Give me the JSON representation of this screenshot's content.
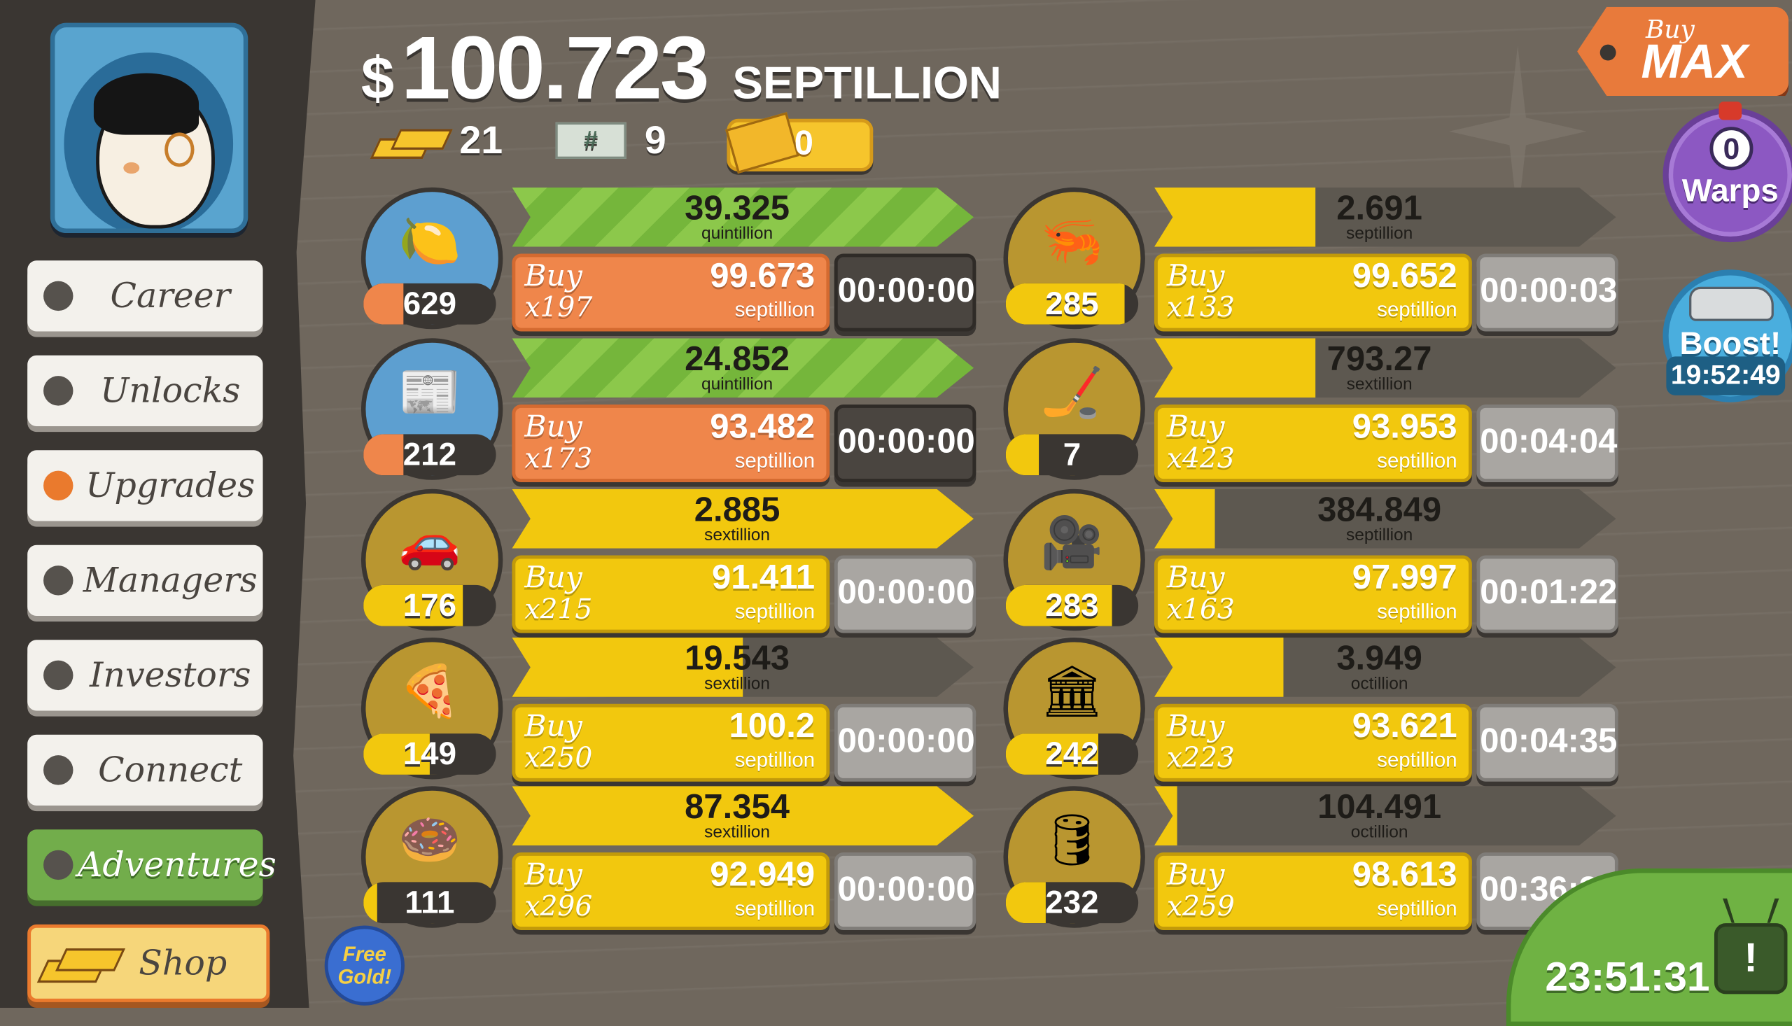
{
  "header": {
    "currency_symbol": "$",
    "money_amount": "100.723",
    "money_unit": "SEPTILLION",
    "gold_count": "21",
    "megabucks_count": "9",
    "megabuck_symbol": "#",
    "tickets_count": "0"
  },
  "buy_max": {
    "line1": "Buy",
    "line2": "MAX"
  },
  "warps": {
    "count": "0",
    "label": "Warps"
  },
  "boost": {
    "label": "Boost!",
    "timer": "19:52:49"
  },
  "menu": {
    "career": "Career",
    "unlocks": "Unlocks",
    "upgrades": "Upgrades",
    "managers": "Managers",
    "investors": "Investors",
    "connect": "Connect",
    "adventures": "Adventures",
    "shop": "Shop"
  },
  "free_gold": {
    "line1": "Free",
    "line2": "Gold!"
  },
  "tv_timer": "23:51:31",
  "tv_icon": "!",
  "colors": {
    "bar_green": "#8cc84b",
    "bar_yellow": "#f2c80e",
    "buy_orange": "#ef864b",
    "buy_yellow": "#f2c80e",
    "owned_fill": "#f2c80e",
    "owned_fill_orange": "#ef864b"
  },
  "businesses": [
    {
      "icon": "lemon-icon",
      "glyph": "🍋",
      "owned": "629",
      "owned_progress": 0.3,
      "owned_fill": "orange",
      "circle": "blue",
      "revenue": "39.325",
      "revenue_unit": "quintillion",
      "bar_progress": 1.0,
      "bar_style": "green",
      "buy_label": "Buy",
      "buy_qty": "x197",
      "price": "99.673",
      "price_unit": "septillion",
      "buy_style": "orange",
      "timer": "00:00:00",
      "timer_style": "dark"
    },
    {
      "icon": "newspaper-icon",
      "glyph": "📰",
      "owned": "212",
      "owned_progress": 0.3,
      "owned_fill": "orange",
      "circle": "blue",
      "revenue": "24.852",
      "revenue_unit": "quintillion",
      "bar_progress": 1.0,
      "bar_style": "green",
      "buy_label": "Buy",
      "buy_qty": "x173",
      "price": "93.482",
      "price_unit": "septillion",
      "buy_style": "orange",
      "timer": "00:00:00",
      "timer_style": "dark"
    },
    {
      "icon": "car-wash-icon",
      "glyph": "🚗",
      "owned": "176",
      "owned_progress": 0.75,
      "owned_fill": "yellow",
      "circle": "gold",
      "revenue": "2.885",
      "revenue_unit": "sextillion",
      "bar_progress": 1.0,
      "bar_style": "yellow",
      "buy_label": "Buy",
      "buy_qty": "x215",
      "price": "91.411",
      "price_unit": "septillion",
      "buy_style": "yellow",
      "timer": "00:00:00",
      "timer_style": "light"
    },
    {
      "icon": "pizza-icon",
      "glyph": "🍕",
      "owned": "149",
      "owned_progress": 0.5,
      "owned_fill": "yellow",
      "circle": "gold",
      "revenue": "19.543",
      "revenue_unit": "sextillion",
      "bar_progress": 0.5,
      "bar_style": "yellow",
      "buy_label": "Buy",
      "buy_qty": "x250",
      "price": "100.2",
      "price_unit": "septillion",
      "buy_style": "yellow",
      "timer": "00:00:00",
      "timer_style": "light"
    },
    {
      "icon": "donut-icon",
      "glyph": "🍩",
      "owned": "111",
      "owned_progress": 0.1,
      "owned_fill": "yellow",
      "circle": "gold",
      "revenue": "87.354",
      "revenue_unit": "sextillion",
      "bar_progress": 1.0,
      "bar_style": "yellow",
      "buy_label": "Buy",
      "buy_qty": "x296",
      "price": "92.949",
      "price_unit": "septillion",
      "buy_style": "yellow",
      "timer": "00:00:00",
      "timer_style": "light"
    },
    {
      "icon": "shrimp-icon",
      "glyph": "🦐",
      "owned": "285",
      "owned_progress": 0.9,
      "owned_fill": "yellow",
      "circle": "gold",
      "revenue": "2.691",
      "revenue_unit": "septillion",
      "bar_progress": 0.35,
      "bar_style": "yellow",
      "buy_label": "Buy",
      "buy_qty": "x133",
      "price": "99.652",
      "price_unit": "septillion",
      "buy_style": "yellow",
      "timer": "00:00:03",
      "timer_style": "light"
    },
    {
      "icon": "hockey-icon",
      "glyph": "🏒",
      "owned": "7",
      "owned_progress": 0.25,
      "owned_fill": "yellow",
      "circle": "gold",
      "revenue": "793.27",
      "revenue_unit": "sextillion",
      "bar_progress": 0.35,
      "bar_style": "yellow",
      "buy_label": "Buy",
      "buy_qty": "x423",
      "price": "93.953",
      "price_unit": "septillion",
      "buy_style": "yellow",
      "timer": "00:04:04",
      "timer_style": "light"
    },
    {
      "icon": "movie-camera-icon",
      "glyph": "🎥",
      "owned": "283",
      "owned_progress": 0.8,
      "owned_fill": "yellow",
      "circle": "gold",
      "revenue": "384.849",
      "revenue_unit": "septillion",
      "bar_progress": 0.13,
      "bar_style": "yellow",
      "buy_label": "Buy",
      "buy_qty": "x163",
      "price": "97.997",
      "price_unit": "septillion",
      "buy_style": "yellow",
      "timer": "00:01:22",
      "timer_style": "light"
    },
    {
      "icon": "bank-icon",
      "glyph": "🏛",
      "owned": "242",
      "owned_progress": 0.7,
      "owned_fill": "yellow",
      "circle": "gold",
      "revenue": "3.949",
      "revenue_unit": "octillion",
      "bar_progress": 0.28,
      "bar_style": "yellow",
      "buy_label": "Buy",
      "buy_qty": "x223",
      "price": "93.621",
      "price_unit": "septillion",
      "buy_style": "yellow",
      "timer": "00:04:35",
      "timer_style": "light"
    },
    {
      "icon": "oil-rig-icon",
      "glyph": "🛢",
      "owned": "232",
      "owned_progress": 0.3,
      "owned_fill": "yellow",
      "circle": "gold",
      "revenue": "104.491",
      "revenue_unit": "octillion",
      "bar_progress": 0.05,
      "bar_style": "yellow",
      "buy_label": "Buy",
      "buy_qty": "x259",
      "price": "98.613",
      "price_unit": "septillion",
      "buy_style": "yellow",
      "timer": "00:36:35",
      "timer_style": "light"
    }
  ]
}
